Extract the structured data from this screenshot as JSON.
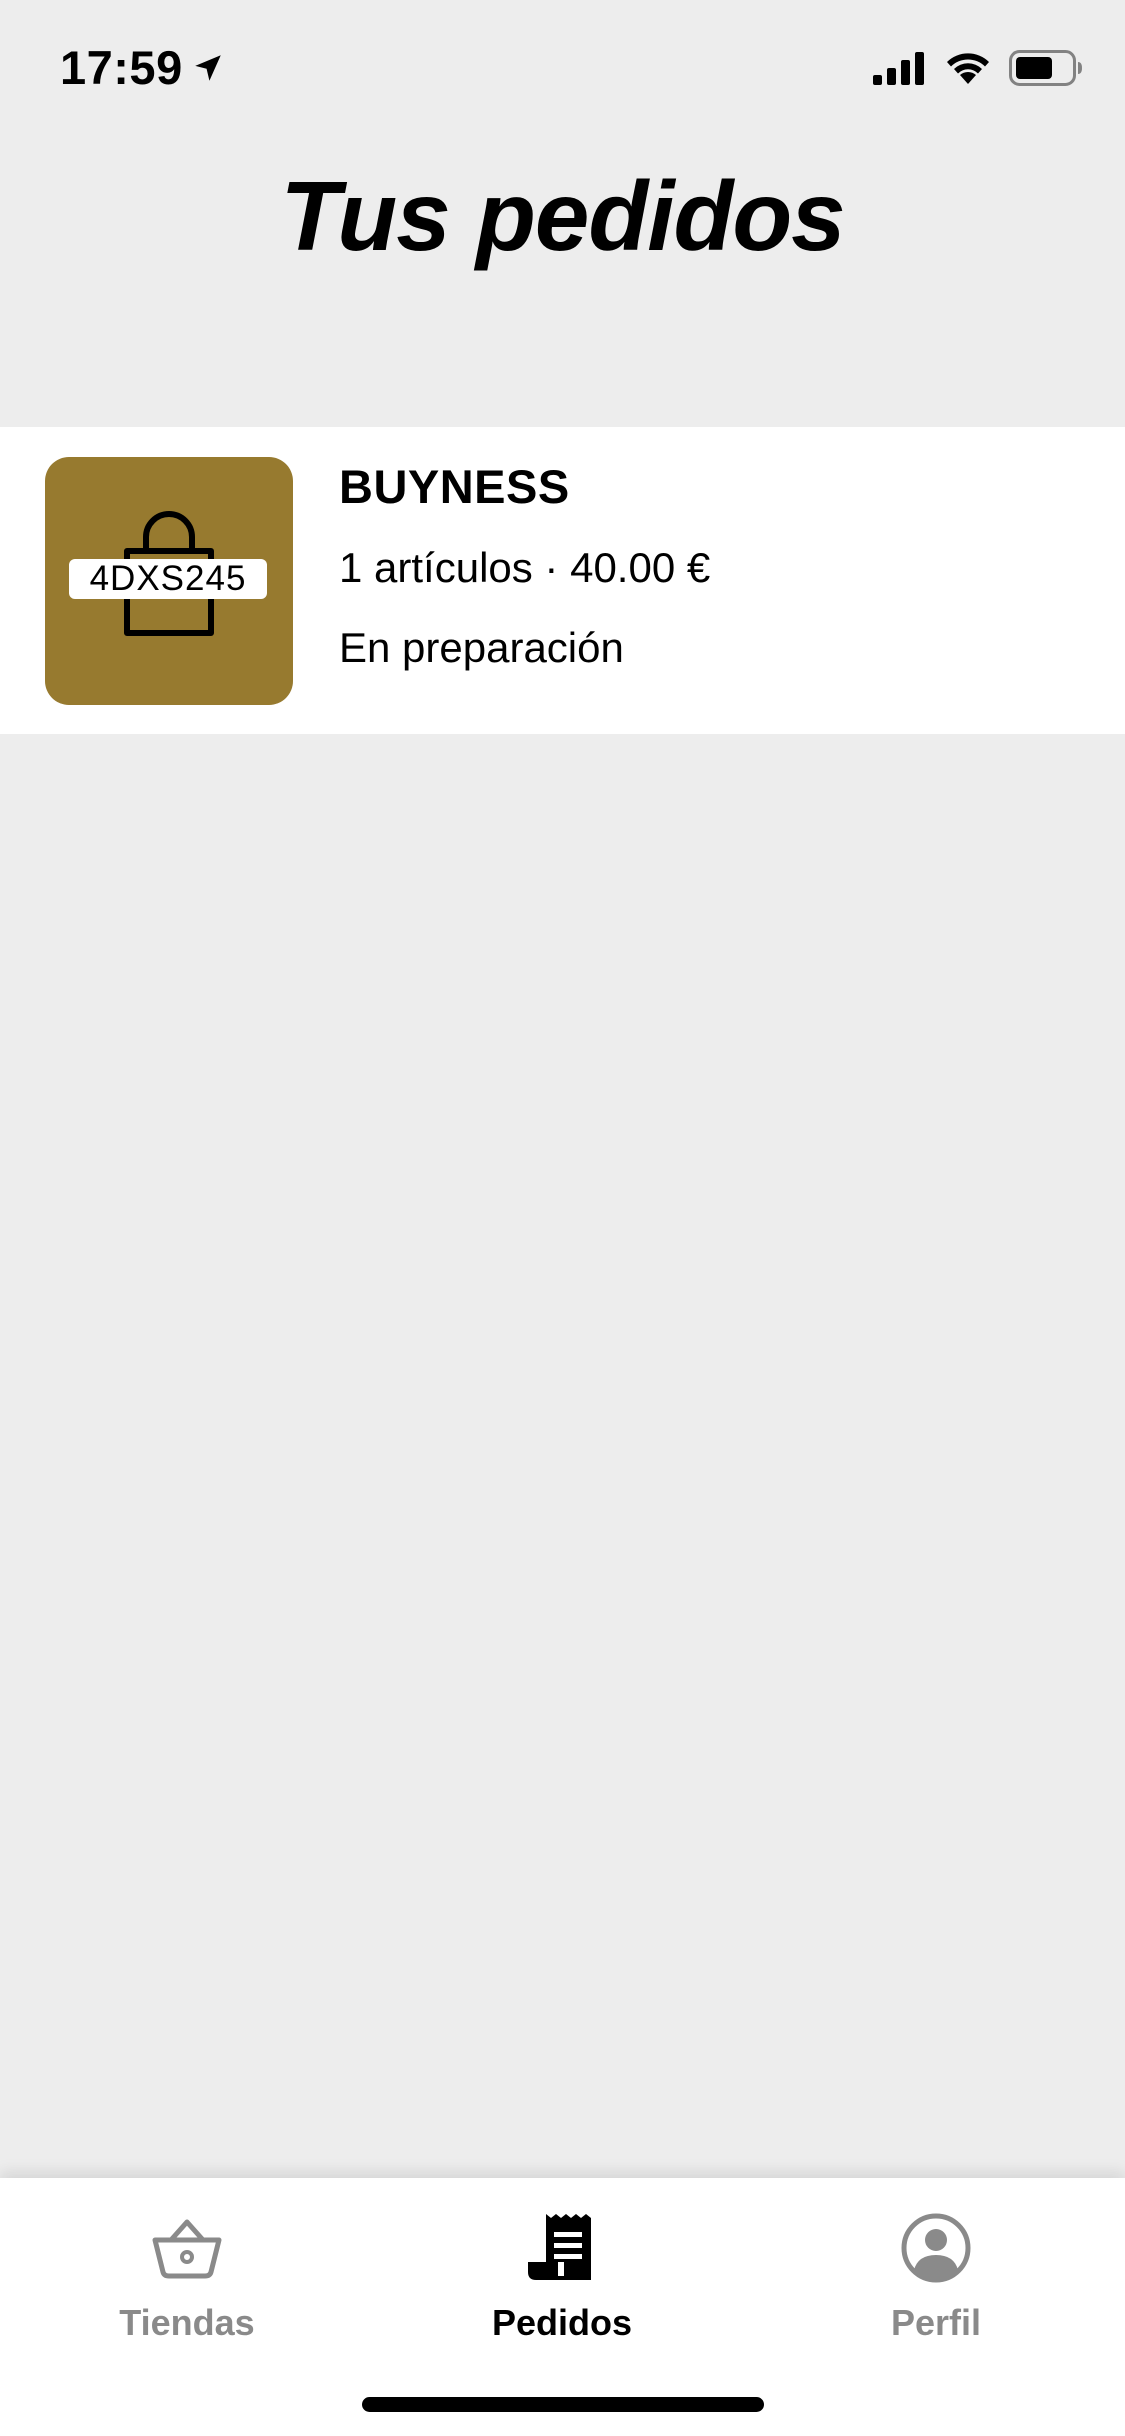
{
  "status_bar": {
    "time": "17:59",
    "location_icon": "location-arrow-icon",
    "signal_icon": "cellular-signal-icon",
    "wifi_icon": "wifi-icon",
    "battery_icon": "battery-icon"
  },
  "header": {
    "title": "Tus pedidos"
  },
  "orders": [
    {
      "code": "4DXS245",
      "thumb_icon": "shopping-bag-icon",
      "thumb_color": "#977a2f",
      "store": "BUYNESS",
      "summary": "1 artículos · 40.00 €",
      "status": "En preparación"
    }
  ],
  "tab_bar": {
    "tabs": [
      {
        "label": "Tiendas",
        "icon": "basket-icon",
        "active": false
      },
      {
        "label": "Pedidos",
        "icon": "receipt-icon",
        "active": true
      },
      {
        "label": "Perfil",
        "icon": "profile-icon",
        "active": false
      }
    ],
    "active_color": "#000000",
    "inactive_color": "#8a8a8a"
  }
}
